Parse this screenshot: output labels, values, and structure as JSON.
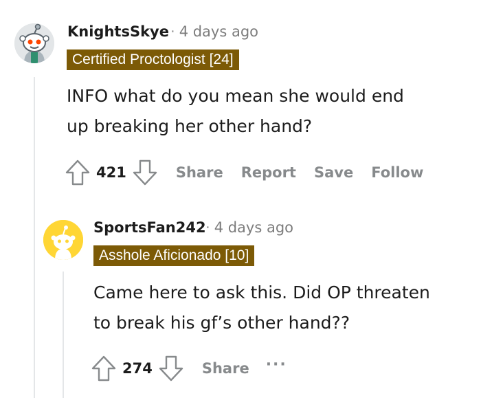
{
  "comments": [
    {
      "username": "KnightsSkye",
      "separator": "·",
      "timestamp": "4 days ago",
      "flair": "Certified Proctologist [24]",
      "body_lines": [
        "INFO what do you mean she would end",
        "up breaking her other hand?"
      ],
      "score": "421",
      "actions": [
        "Share",
        "Report",
        "Save",
        "Follow"
      ]
    },
    {
      "username": "SportsFan242",
      "separator": "·",
      "timestamp": "4 days ago",
      "flair": "Asshole Aficionado [10]",
      "body_lines": [
        "Came here to ask this. Did OP threaten",
        "to break his gf’s other hand??"
      ],
      "score": "274",
      "actions": [
        "Share"
      ],
      "more_label": "···"
    }
  ],
  "colors": {
    "flair_bg": "#7c5a06",
    "flair_text": "#ffffff",
    "action_gray": "#878a8c",
    "thread_line": "#e4e6e8",
    "avatar1_bg": "#e3e6e8",
    "avatar2_bg": "#ffd635"
  },
  "icons": {
    "upvote": "upvote-arrow-icon",
    "downvote": "downvote-arrow-icon",
    "more": "more-options-icon"
  }
}
